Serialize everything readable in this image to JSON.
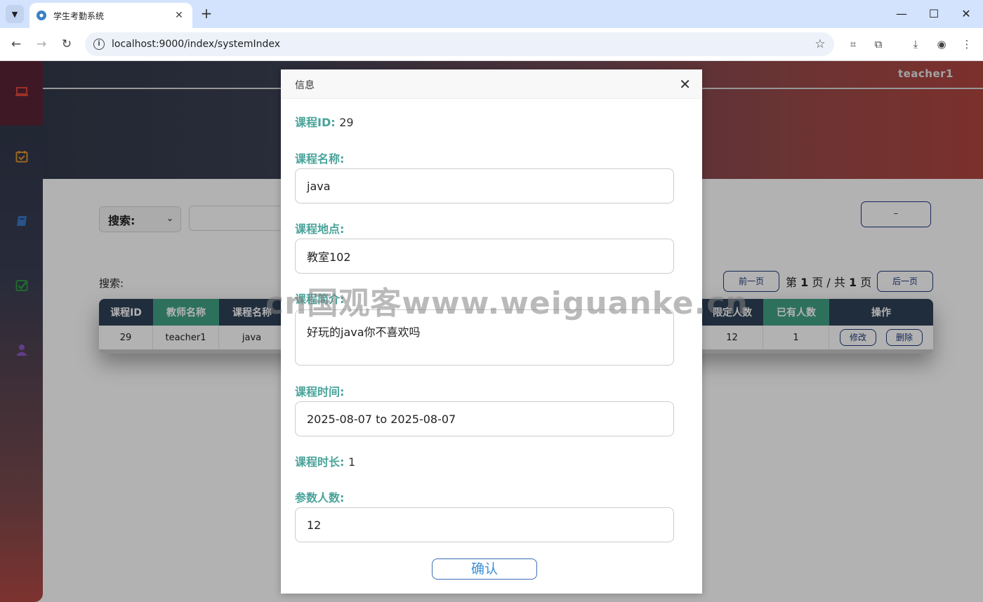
{
  "browser": {
    "tab_title": "学生考勤系统",
    "tab_close": "✕",
    "new_tab": "+",
    "url": "localhost:9000/index/systemIndex",
    "window_controls": {
      "minimize": "—",
      "maximize": "☐",
      "close": "✕"
    }
  },
  "sidebar": {
    "items": [
      {
        "icon": "laptop-icon",
        "color": "#e0453a",
        "active": true
      },
      {
        "icon": "calendar-check-icon",
        "color": "#e0922f",
        "active": false
      },
      {
        "icon": "book-icon",
        "color": "#3b78c4",
        "active": false
      },
      {
        "icon": "check-icon",
        "color": "#2d9a44",
        "active": false
      },
      {
        "icon": "user-icon",
        "color": "#8a5ac4",
        "active": false
      }
    ]
  },
  "header": {
    "user": "teacher1"
  },
  "search": {
    "select_label": "搜索:",
    "right_button": "–"
  },
  "list": {
    "search_label": "搜索:",
    "prev_button": "前一页",
    "next_button": "后一页",
    "page_prefix": "第",
    "page_current": "1",
    "page_middle": "页 / 共",
    "page_total": "1",
    "page_suffix": "页"
  },
  "table": {
    "columns": [
      "课程ID",
      "教师名称",
      "课程名称",
      "限定人数",
      "已有人数",
      "操作"
    ],
    "rows": [
      {
        "course_id": "29",
        "teacher": "teacher1",
        "course_name": "java",
        "limit": "12",
        "current": "1",
        "edit": "修改",
        "delete": "删除"
      }
    ]
  },
  "dialog": {
    "title": "信息",
    "close": "✕",
    "course_id_label": "课程ID:",
    "course_id_value": "29",
    "name_label": "课程名称:",
    "name_value": "java",
    "location_label": "课程地点:",
    "location_value": "教室102",
    "intro_label": "课程简介:",
    "intro_value": "好玩的java你不喜欢吗",
    "time_label": "课程时间:",
    "time_value": "2025-08-07 to 2025-08-07",
    "duration_label": "课程时长:",
    "duration_value": "1",
    "count_label": "参数人数:",
    "count_value": "12",
    "confirm": "确认"
  },
  "watermark": "cn国观客www.weiguanke.cn"
}
